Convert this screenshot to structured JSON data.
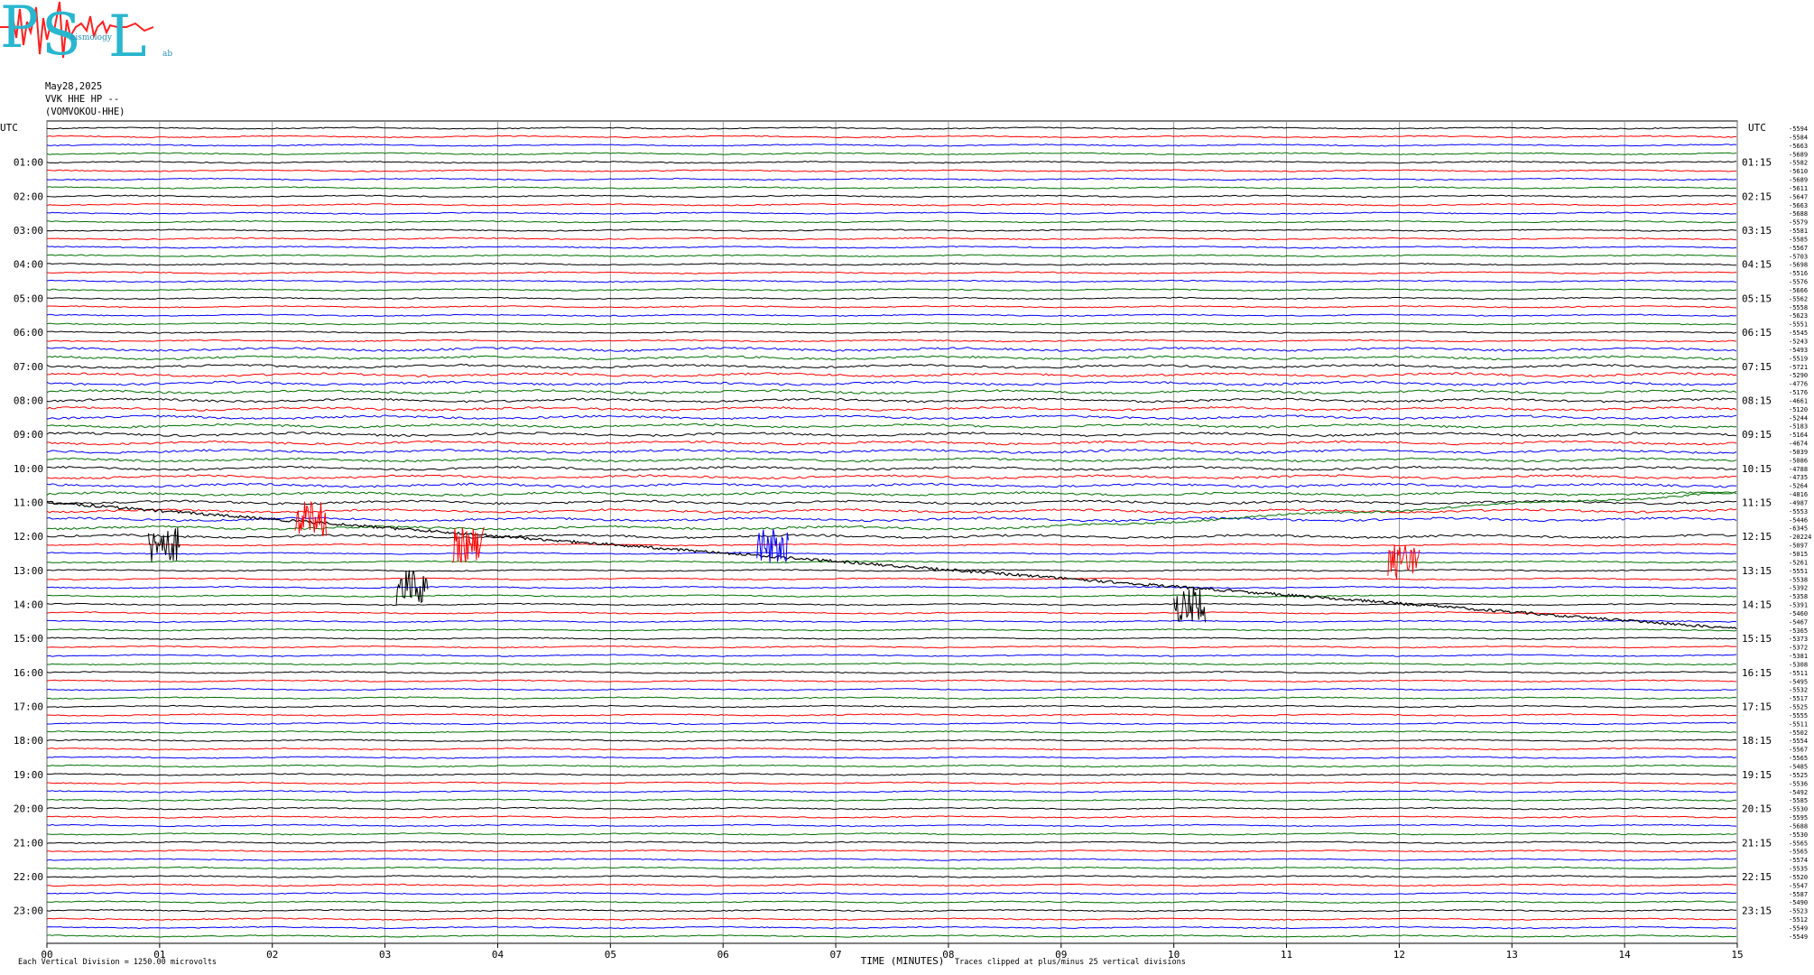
{
  "logo": {
    "letters": [
      "P",
      "S",
      "L"
    ],
    "words": [
      "eismology",
      "ab"
    ],
    "color": "#29b6cf",
    "wave_color": "#ff2020"
  },
  "header": {
    "date": "May28,2025",
    "station": "VVK HHE HP --",
    "location": "(VOMVOKOU-HHE)"
  },
  "footer": {
    "scale_note": "Each Vertical Division = 1250.00 microvolts",
    "time_axis_title": "TIME (MINUTES)",
    "clip_note": "Traces clipped at plus/minus 25 vertical divisions"
  },
  "chart_data": {
    "type": "line",
    "subtype": "helicorder",
    "x_unit": "minutes",
    "xlim": [
      0,
      15
    ],
    "x_ticks": [
      "00",
      "01",
      "02",
      "03",
      "04",
      "05",
      "06",
      "07",
      "08",
      "09",
      "10",
      "11",
      "12",
      "13",
      "14",
      "15"
    ],
    "left_axis_label": "UTC",
    "right_axis_label": "UTC",
    "left_hour_labels": [
      "01:00",
      "02:00",
      "03:00",
      "04:00",
      "05:00",
      "06:00",
      "07:00",
      "08:00",
      "09:00",
      "10:00",
      "11:00",
      "12:00",
      "13:00",
      "14:00",
      "15:00",
      "16:00",
      "17:00",
      "18:00",
      "19:00",
      "20:00",
      "21:00",
      "22:00",
      "23:00"
    ],
    "right_hour_labels": [
      "01:15",
      "02:15",
      "03:15",
      "04:15",
      "05:15",
      "06:15",
      "07:15",
      "08:15",
      "09:15",
      "10:15",
      "11:15",
      "12:15",
      "13:15",
      "14:15",
      "15:15",
      "16:15",
      "17:15",
      "18:15",
      "19:15",
      "20:15",
      "21:15",
      "22:15",
      "23:15"
    ],
    "trace_count": 96,
    "trace_color_cycle": [
      "#000000",
      "#ff0000",
      "#0000ff",
      "#007000"
    ],
    "grid": true,
    "trace_offsets": [
      "-5594",
      "-5584",
      "-5663",
      "-5689",
      "-5582",
      "-5610",
      "-5689",
      "-5611",
      "-5647",
      "-5663",
      "-5688",
      "-5579",
      "-5581",
      "-5585",
      "-5567",
      "-5703",
      "-5698",
      "-5516",
      "-5576",
      "-5666",
      "-5562",
      "-5558",
      "-5623",
      "-5551",
      "-5545",
      "-5243",
      "-5493",
      "-5519",
      "-5721",
      "-5290",
      "-4776",
      "-5176",
      "-4661",
      "-5120",
      "-5244",
      "-5183",
      "-5164",
      "-4674",
      "-5039",
      "-5086",
      "-4788",
      "-4735",
      "-5264",
      "-4816",
      "-4987",
      "-5553",
      "-5446",
      "-6345",
      "-20224",
      "-5097",
      "-5015",
      "-5261",
      "-5551",
      "-5538",
      "-5392",
      "-5358",
      "-5391",
      "-5460",
      "-5467",
      "-5365",
      "-5373",
      "-5372",
      "-5381",
      "-5308",
      "-5511",
      "-5495",
      "-5532",
      "-5517",
      "-5525",
      "-5555",
      "-5511",
      "-5502",
      "-5554",
      "-5567",
      "-5565",
      "-5485",
      "-5525",
      "-5536",
      "-5492",
      "-5585",
      "-5530",
      "-5595",
      "-5688",
      "-5530",
      "-5565",
      "-5565",
      "-5574",
      "-5535",
      "-5520",
      "-5547",
      "-5587",
      "-5490",
      "-5523",
      "-5512",
      "-5549",
      "-5549"
    ]
  }
}
